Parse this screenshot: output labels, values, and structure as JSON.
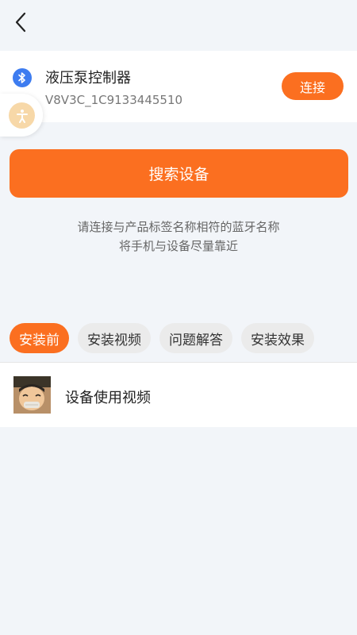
{
  "nav": {
    "back_icon": "chevron-left-icon"
  },
  "device": {
    "icon": "bluetooth-icon",
    "name": "液压泵控制器",
    "id": "V8V3C_1C9133445510",
    "connect_label": "连接"
  },
  "floating": {
    "icon": "accessibility-icon"
  },
  "search": {
    "label": "搜索设备",
    "hint_line1": "请连接与产品标签名称相符的蓝牙名称",
    "hint_line2": "将手机与设备尽量靠近"
  },
  "tabs": [
    {
      "label": "安装前",
      "active": true
    },
    {
      "label": "安装视频",
      "active": false
    },
    {
      "label": "问题解答",
      "active": false
    },
    {
      "label": "安装效果",
      "active": false
    }
  ],
  "video": {
    "title": "设备使用视频",
    "thumbnail": "cartoon-character-thumbnail"
  },
  "colors": {
    "accent": "#fb6f20",
    "background": "#f2f5f9",
    "bluetooth": "#3d7cf0"
  }
}
